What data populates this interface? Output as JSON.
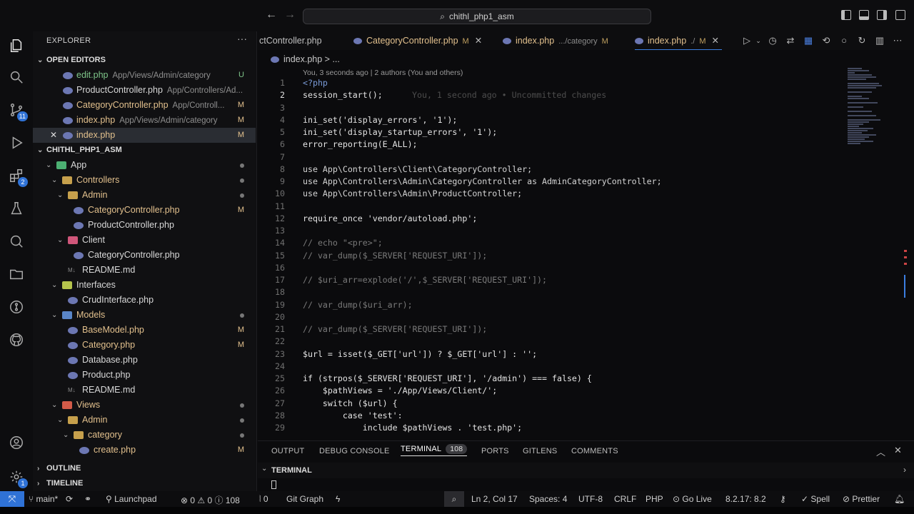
{
  "titlebar": {
    "search_text": "chithl_php1_asm"
  },
  "activity": {
    "scm_badge": "11",
    "ext_badge": "2",
    "settings_badge": "1"
  },
  "sidebar": {
    "title": "EXPLORER",
    "more": "···",
    "open_editors": {
      "label": "OPEN EDITORS",
      "items": [
        {
          "name": "edit.php",
          "path": "App/Views/Admin/category",
          "status": "U"
        },
        {
          "name": "ProductController.php",
          "path": "App/Controllers/Ad...",
          "status": ""
        },
        {
          "name": "CategoryController.php",
          "path": "App/Controll...",
          "status": "M"
        },
        {
          "name": "index.php",
          "path": "App/Views/Admin/category",
          "status": "M"
        },
        {
          "name": "index.php",
          "path": "",
          "status": "M"
        }
      ]
    },
    "project": {
      "label": "CHITHL_PHP1_ASM",
      "tree": [
        {
          "name": "App",
          "status": "dot"
        },
        {
          "name": "Controllers",
          "status": "dot"
        },
        {
          "name": "Admin",
          "status": "dot"
        },
        {
          "name": "CategoryController.php",
          "status": "M"
        },
        {
          "name": "ProductController.php",
          "status": ""
        },
        {
          "name": "Client",
          "status": ""
        },
        {
          "name": "CategoryController.php",
          "status": ""
        },
        {
          "name": "README.md",
          "status": ""
        },
        {
          "name": "Interfaces",
          "status": ""
        },
        {
          "name": "CrudInterface.php",
          "status": ""
        },
        {
          "name": "Models",
          "status": "dot"
        },
        {
          "name": "BaseModel.php",
          "status": "M"
        },
        {
          "name": "Category.php",
          "status": "M"
        },
        {
          "name": "Database.php",
          "status": ""
        },
        {
          "name": "Product.php",
          "status": ""
        },
        {
          "name": "README.md",
          "status": ""
        },
        {
          "name": "Views",
          "status": "dot"
        },
        {
          "name": "Admin",
          "status": "dot"
        },
        {
          "name": "category",
          "status": "dot"
        },
        {
          "name": "create.php",
          "status": "M"
        }
      ]
    },
    "outline": "OUTLINE",
    "timeline": "TIMELINE"
  },
  "tabs": [
    {
      "label": "ctController.php",
      "desc": "",
      "mark": ""
    },
    {
      "label": "CategoryController.php",
      "desc": "",
      "mark": "M"
    },
    {
      "label": "index.php",
      "desc": ".../category",
      "mark": "M"
    },
    {
      "label": "index.php",
      "desc": "./",
      "mark": "M"
    }
  ],
  "editor": {
    "breadcrumb": "index.php  >  ...",
    "blame": "You, 3 seconds ago | 2 authors (You and others)",
    "ghost": "You, 1 second ago • Uncommitted changes",
    "lines": [
      {
        "n": "1",
        "t": "<?php"
      },
      {
        "n": "2",
        "t": "session_start();"
      },
      {
        "n": "3",
        "t": ""
      },
      {
        "n": "4",
        "t": "ini_set('display_errors', '1');"
      },
      {
        "n": "5",
        "t": "ini_set('display_startup_errors', '1');"
      },
      {
        "n": "6",
        "t": "error_reporting(E_ALL);"
      },
      {
        "n": "7",
        "t": ""
      },
      {
        "n": "8",
        "t": "use App\\Controllers\\Client\\CategoryController;"
      },
      {
        "n": "9",
        "t": "use App\\Controllers\\Admin\\CategoryController as AdminCategoryController;"
      },
      {
        "n": "10",
        "t": "use App\\Controllers\\Admin\\ProductController;"
      },
      {
        "n": "11",
        "t": ""
      },
      {
        "n": "12",
        "t": "require_once 'vendor/autoload.php';"
      },
      {
        "n": "13",
        "t": ""
      },
      {
        "n": "14",
        "t": "// echo \"<pre>\";"
      },
      {
        "n": "15",
        "t": "// var_dump($_SERVER['REQUEST_URI']);"
      },
      {
        "n": "16",
        "t": ""
      },
      {
        "n": "17",
        "t": "// $uri_arr=explode('/',$_SERVER['REQUEST_URI']);"
      },
      {
        "n": "18",
        "t": ""
      },
      {
        "n": "19",
        "t": "// var_dump($uri_arr);"
      },
      {
        "n": "20",
        "t": ""
      },
      {
        "n": "21",
        "t": "// var_dump($_SERVER['REQUEST_URI']);"
      },
      {
        "n": "22",
        "t": ""
      },
      {
        "n": "23",
        "t": "$url = isset($_GET['url']) ? $_GET['url'] : '';"
      },
      {
        "n": "24",
        "t": ""
      },
      {
        "n": "25",
        "t": "if (strpos($_SERVER['REQUEST_URI'], '/admin') === false) {"
      },
      {
        "n": "26",
        "t": "    $pathViews = './App/Views/Client/';"
      },
      {
        "n": "27",
        "t": "    switch ($url) {"
      },
      {
        "n": "28",
        "t": "        case 'test':"
      },
      {
        "n": "29",
        "t": "            include $pathViews . 'test.php';"
      }
    ]
  },
  "panel": {
    "tabs": [
      "OUTPUT",
      "DEBUG CONSOLE",
      "TERMINAL",
      "PORTS",
      "GITLENS",
      "COMMENTS"
    ],
    "terminal_count": "108",
    "terminal_label": "TERMINAL"
  },
  "status": {
    "branch": "main*",
    "launchpad": "Launchpad",
    "problems": "⊗ 0 ⚠ 0 ⓘ 108",
    "ports": "0",
    "gitgraph": "Git Graph",
    "position": "Ln 2, Col 17",
    "spaces": "Spaces: 4",
    "encoding": "UTF-8",
    "eol": "CRLF",
    "language": "PHP",
    "golive": "Go Live",
    "php_version": "8.2.17: 8.2",
    "spell": "Spell",
    "prettier": "Prettier"
  }
}
